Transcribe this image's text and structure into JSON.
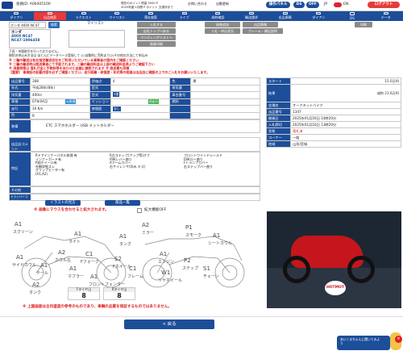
{
  "header": {
    "member": "会員ID: A00405100",
    "notice_line1": "現在のポイント残高 5500 P",
    "notice_line2": "2025年度 1月間 P ポイント 交換所まで",
    "links": [
      "お問い合わせ",
      "自動更新",
      "操作パネル"
    ],
    "ds": "DS",
    "off": "OFF",
    "jp": "JP",
    "en": "EN",
    "logout": "ログアウト"
  },
  "nav": [
    "ダイアン",
    "出品検索",
    "ラクエスト",
    "マイリスト",
    "落札検索",
    "ライブ",
    "成約確認",
    "輸送請求",
    "出品車輌",
    "ダイアン",
    "DS",
    "データ"
  ],
  "search": {
    "value": "ホンダ 400X NC47",
    "button": "検索",
    "list_label": "マイリスト"
  },
  "car_list": [
    "ホンダ",
    "400X NC47",
    "NC47-1006458"
  ],
  "center_btns": [
    "入札する",
    "応札トップへ戻る",
    "ペンディングリストへ",
    "画像印刷"
  ],
  "right_btns": [
    "画像追加",
    "出品情報",
    "入札・申込状況",
    "クレーム・補足説明",
    "印刷"
  ],
  "notes": {
    "n1": "下見・市場取引を行っておりません。",
    "n2": "現状の申込み方法は ほとんどデータベース登録して (1)自動的に売約まで(2)その他の方法にて申込み",
    "n3": "※ 二輪の輸送は各社指定輸送会社をご利用いただいている事業者の案内をご確認ください",
    "n4": "※ 二輪の輸送時は陸送業者にて手配されます。二輪の輸送料金は上部の輸送料金表よりご確認下さい",
    "n5": "※ 消費税等は 落札代金と手数料等を合わせた金額に課税されます ※ 陸送費も同様",
    "n6": "【重要】 車検証の記載内容を必ずご確認ください。走行距離・修復歴・年式等の相違は出品店に確認の上でのご入札をお願いいたします。"
  },
  "spec": [
    {
      "k": "出品番号",
      "v": "308",
      "k2": "評価点",
      "v2": "4",
      "k3": "色",
      "v3": "黒"
    },
    {
      "k": "年式",
      "v": "平成28年(8年)",
      "k2": "型式",
      "v2": "",
      "k3": "排気量",
      "v3": ""
    },
    {
      "k": "排気量",
      "v": "400cc",
      "k2": "型式",
      "v2": "",
      "k3": "車台番号",
      "v3": ""
    },
    {
      "k": "車検",
      "v": "07年04月",
      "k2": "ミッション",
      "v2": "",
      "k3": "燃料",
      "v3": ""
    },
    {
      "k": "走行",
      "v": "34 Km",
      "k2": "修復歴",
      "v2": "",
      "k3": "",
      "v3": ""
    },
    {
      "k": "色",
      "v": "R",
      "k2": "",
      "v2": "",
      "k3": "",
      "v3": ""
    }
  ],
  "spec_tags": {
    "t1": "公表値",
    "t2": "低走行",
    "t3": "5速",
    "t4": "なし"
  },
  "equip_label": "装備",
  "equip_value": "ETC スマホホルダー USB メットホルダー",
  "comment_label": "出品店コメント",
  "special_label": "特記",
  "special_cols": [
    [
      "Rドアインナーパネル修理 有",
      "インナーガード有",
      "R前ホイール有",
      "外観状態スレ",
      "グリップヒーター有",
      "(A1,A2)"
    ],
    [
      "R左ステップ(アップ等)オフ",
      "FBKレバー曲り",
      "Aアームカバー",
      "右サイレンサ(凹み キズ)"
    ],
    [
      "フロントウインドシールド",
      "FBKロー曲り",
      "Fトランプカバー",
      "右ステップバー曲り"
    ]
  ],
  "other_label": "その他",
  "user_label": "ドライバーコメント",
  "side": [
    {
      "k": "スタート",
      "v": "15.0万円"
    },
    {
      "k": "結果",
      "v": "成約 21.6万円"
    },
    {
      "k": "会場名",
      "v": "オークネットバイク"
    },
    {
      "k": "出品番号",
      "v": "1347"
    },
    {
      "k": "開催日",
      "v": "2025年01月16日 14時20分"
    },
    {
      "k": "入札締切",
      "v": "2025年01月16日 13時20分"
    },
    {
      "k": "状態",
      "v": "落札済"
    },
    {
      "k": "コーナー",
      "v": "一般"
    },
    {
      "k": "地域",
      "v": "山形/宮城"
    }
  ],
  "mid_btns": {
    "b1": "イラストの見方",
    "b2": "部品一覧"
  },
  "image_note": "※ 画像にマウスを合わせると拡大されます。",
  "zoom_off": "拡大機能OFF",
  "parts": [
    "A1",
    "スクリーン",
    "A1",
    "ライト",
    "A1",
    "タンク",
    "A2",
    "ミラー",
    "P1",
    "スモーク",
    "A1",
    "シートカウル",
    "A1",
    "サイドカウル",
    "A1",
    "テール",
    "A2",
    "カウル左",
    "C1",
    "Fフォーク",
    "S2",
    "Fホイール",
    "A1",
    "エンジン",
    "P2",
    "ステップ",
    "A1",
    "マフラー",
    "C1",
    "フレーム",
    "W1",
    "リヤホイール",
    "A1",
    "フロントフェンダー",
    "S1",
    "チェーン",
    "A2",
    "タンク"
  ],
  "tread": [
    {
      "k": "Fタイヤ山",
      "v": "8"
    },
    {
      "k": "Rタイヤ山",
      "v": "8"
    }
  ],
  "footnote": "※ 上図画面は全目盛度の参考のものであり、車輌の品質を保証するものではありません。",
  "back": "< 戻る",
  "brand": "HOTMOT",
  "bubble": "あいくるちゃんに聞いてみよう",
  "colors": {
    "navy": "#1d4e9a",
    "red": "#e02020"
  }
}
